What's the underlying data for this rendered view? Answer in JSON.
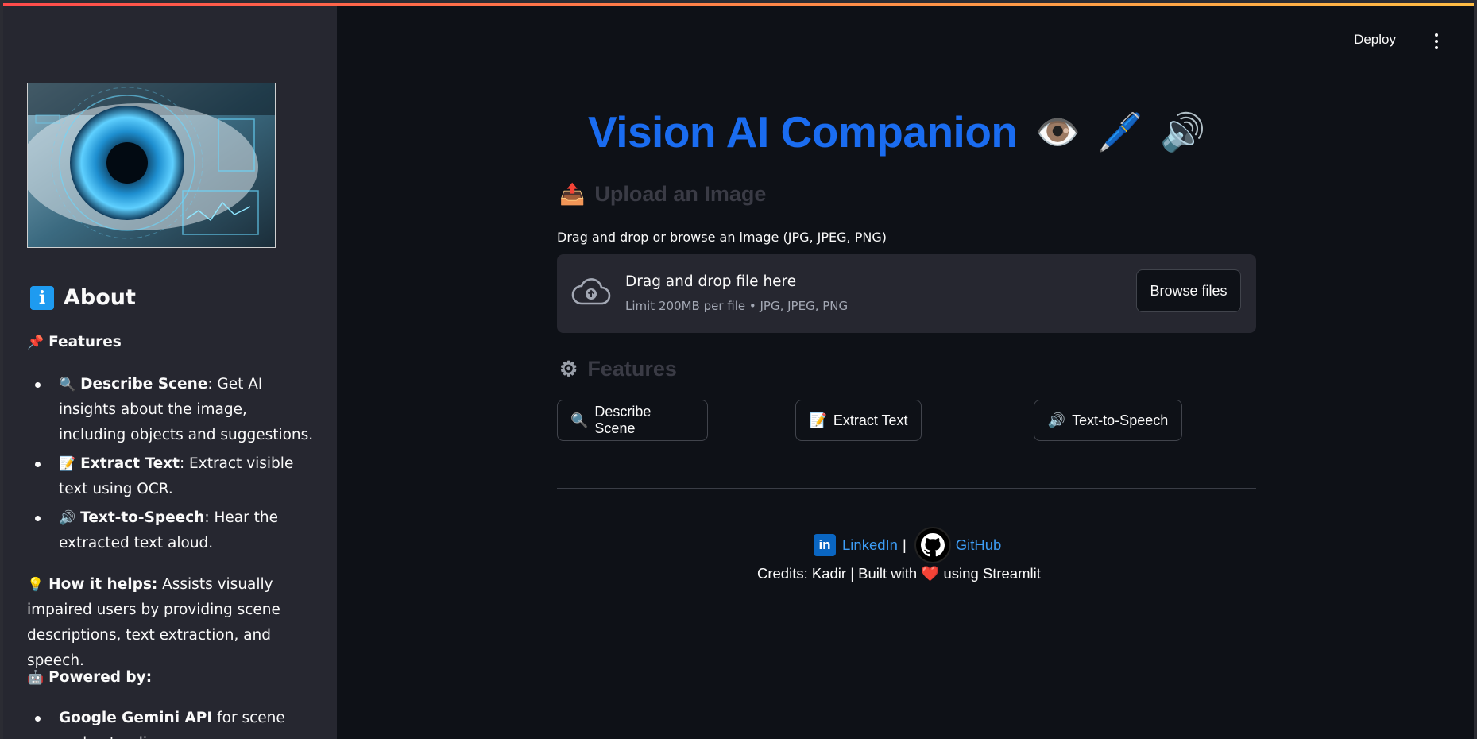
{
  "header": {
    "deploy_label": "Deploy"
  },
  "sidebar": {
    "about_title": "About",
    "features_heading": "Features",
    "features": [
      {
        "emoji": "🔍",
        "name": "Describe Scene",
        "desc": ": Get AI insights about the image, including objects and suggestions."
      },
      {
        "emoji": "📝",
        "name": "Extract Text",
        "desc": ": Extract visible text using OCR."
      },
      {
        "emoji": "🔊",
        "name": "Text-to-Speech",
        "desc": ": Hear the extracted text aloud."
      }
    ],
    "how_label": "How it helps:",
    "how_text": " Assists visually impaired users by providing scene descriptions, text extraction, and speech.",
    "powered_label": "Powered by:",
    "powered_items": [
      {
        "name": "Google Gemini API",
        "desc": " for scene understanding."
      }
    ]
  },
  "main": {
    "title": "Vision AI Companion",
    "title_emojis": [
      "👁️",
      "🖊️",
      "🔊"
    ],
    "upload_heading": "Upload an Image",
    "upload_label": "Drag and drop or browse an image (JPG, JPEG, PNG)",
    "dropzone": {
      "title": "Drag and drop file here",
      "limit": "Limit 200MB per file • JPG, JPEG, PNG",
      "browse_label": "Browse files"
    },
    "features_heading": "Features",
    "buttons": [
      {
        "emoji": "🔍",
        "label": "Describe Scene"
      },
      {
        "emoji": "📝",
        "label": "Extract Text"
      },
      {
        "emoji": "🔊",
        "label": "Text-to-Speech"
      }
    ]
  },
  "footer": {
    "linkedin_label": " LinkedIn",
    "separator": "|",
    "github_label": " GitHub",
    "credits_prefix": "Credits: Kadir | Built with ",
    "heart": "❤️",
    "credits_suffix": " using Streamlit"
  },
  "colors": {
    "title": "#1a6cf0",
    "link": "#3d9df6",
    "sidebar_bg": "#262730",
    "main_bg": "#0e1117"
  }
}
